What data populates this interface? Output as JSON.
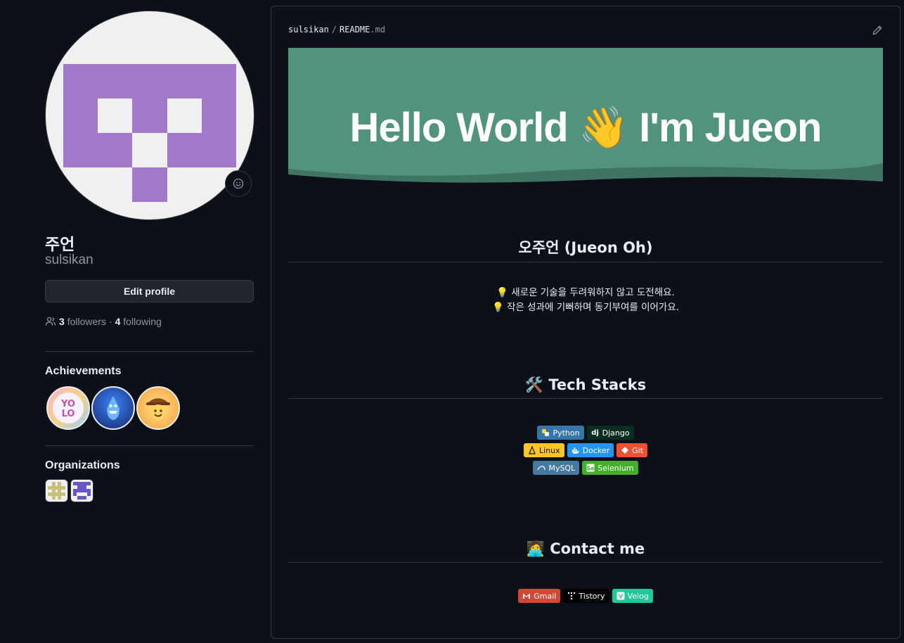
{
  "profile": {
    "display_name": "주언",
    "username": "sulsikan",
    "edit_button": "Edit profile",
    "followers_count": "3",
    "followers_label": "followers",
    "separator": "·",
    "following_count": "4",
    "following_label": "following",
    "avatar_color": "#a279c9"
  },
  "achievements": {
    "title": "Achievements",
    "items": [
      "yolo-badge-icon",
      "pull-shark-badge-icon",
      "quickdraw-badge-icon"
    ]
  },
  "organizations": {
    "title": "Organizations",
    "items": [
      "org-avatar-yellow",
      "org-avatar-purple"
    ]
  },
  "readme": {
    "owner": "sulsikan",
    "slash": "/",
    "file": "README",
    "ext": ".md",
    "banner_title": "Hello World 👋 I'm Jueon",
    "banner_color": "#52937f",
    "name_heading": "오주언 (Jueon Oh)",
    "intro_lines": [
      "💡 새로운 기술을 두려워하지 않고 도전해요.",
      "💡 작은 성과에 기뻐하며 동기부여를 이어가요."
    ],
    "tech_heading": "🛠️ Tech Stacks",
    "contact_heading": "🧑‍💻 Contact me",
    "tech_badges": [
      [
        {
          "label": "Python",
          "color": "#3776ab",
          "icon": "python-icon"
        },
        {
          "label": "Django",
          "color": "#092e20",
          "icon": "django-icon"
        }
      ],
      [
        {
          "label": "Linux",
          "color": "#fcc624",
          "icon": "linux-icon"
        },
        {
          "label": "Docker",
          "color": "#2496ed",
          "icon": "docker-icon"
        },
        {
          "label": "Git",
          "color": "#f05032",
          "icon": "git-icon"
        }
      ],
      [
        {
          "label": "MySQL",
          "color": "#4479a1",
          "icon": "mysql-icon"
        },
        {
          "label": "Selenium",
          "color": "#43b02a",
          "icon": "selenium-icon"
        }
      ]
    ],
    "contact_badges": [
      {
        "label": "Gmail",
        "color": "#d14836",
        "icon": "gmail-icon"
      },
      {
        "label": "Tistory",
        "color": "#000000",
        "icon": "tistory-icon"
      },
      {
        "label": "Velog",
        "color": "#20c997",
        "icon": "velog-icon"
      }
    ]
  }
}
